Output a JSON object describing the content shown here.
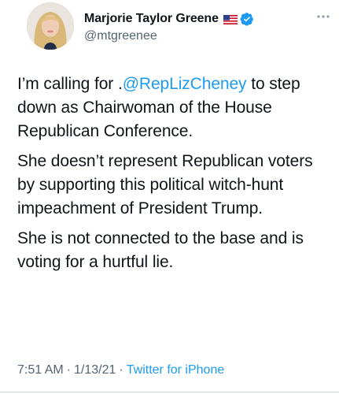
{
  "author": {
    "display_name": "Marjorie Taylor Greene",
    "handle": "@mtgreenee",
    "flag": "us-flag-icon",
    "verified": true
  },
  "tweet": {
    "paragraphs": [
      {
        "prefix": "I’m calling for .",
        "mention": "@RepLizCheney",
        "suffix": " to step down as Chairwoman of the House Republican Conference."
      },
      {
        "text": "She doesn’t represent Republican voters by supporting this political witch-hunt impeachment of President Trump."
      },
      {
        "text": "She is not connected to the base and is voting for a hurtful lie."
      }
    ]
  },
  "meta": {
    "time": "7:51 AM",
    "separator": "·",
    "date": "1/13/21",
    "source": "Twitter for iPhone"
  },
  "colors": {
    "link": "#1d9bf0",
    "secondary_text": "#536471",
    "primary_text": "#0f1419",
    "verified_badge": "#1d9bf0"
  }
}
